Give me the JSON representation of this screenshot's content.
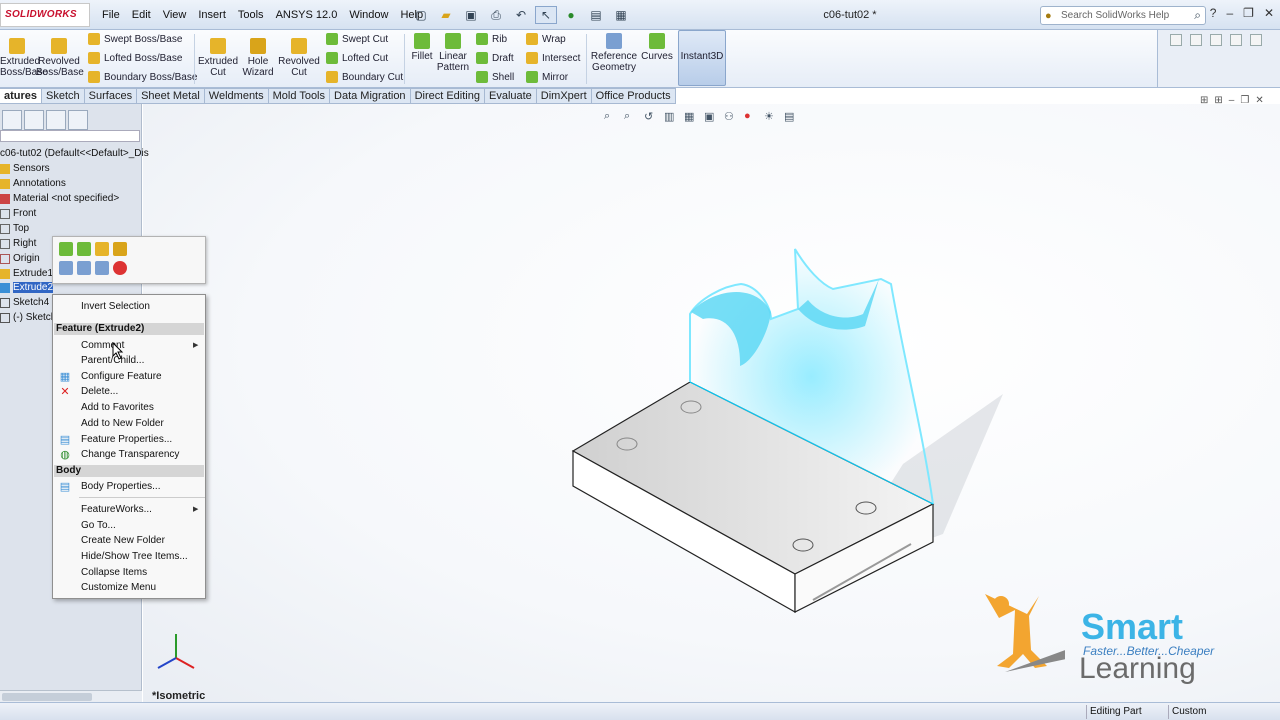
{
  "app": {
    "logo_text": "SOLIDWORKS",
    "doc_title": "c06-tut02 *"
  },
  "menu": [
    "File",
    "Edit",
    "View",
    "Insert",
    "Tools",
    "ANSYS 12.0",
    "Window",
    "Help"
  ],
  "search": {
    "placeholder": "Search SolidWorks Help"
  },
  "ribbon": {
    "big": [
      {
        "label1": "Extruded",
        "label2": "Boss/Base"
      },
      {
        "label1": "Revolved",
        "label2": "Boss/Base"
      },
      {
        "label1": "Extruded",
        "label2": "Cut"
      },
      {
        "label1": "Hole",
        "label2": "Wizard"
      },
      {
        "label1": "Revolved",
        "label2": "Cut"
      },
      {
        "label1": "Fillet",
        "label2": ""
      },
      {
        "label1": "Linear",
        "label2": "Pattern"
      },
      {
        "label1": "Reference",
        "label2": "Geometry"
      },
      {
        "label1": "Curves",
        "label2": ""
      },
      {
        "label1": "Instant3D",
        "label2": ""
      }
    ],
    "small": [
      "Swept Boss/Base",
      "Lofted Boss/Base",
      "Boundary Boss/Base",
      "Swept Cut",
      "Lofted Cut",
      "Boundary Cut",
      "Rib",
      "Draft",
      "Shell",
      "Wrap",
      "Intersect",
      "Mirror"
    ]
  },
  "tabs": [
    "atures",
    "Sketch",
    "Surfaces",
    "Sheet Metal",
    "Weldments",
    "Mold Tools",
    "Data Migration",
    "Direct Editing",
    "Evaluate",
    "DimXpert",
    "Office Products"
  ],
  "tree": [
    "c06-tut02  (Default<<Default>_Dis",
    "Sensors",
    "Annotations",
    "Material <not specified>",
    "Front",
    "Top",
    "Right",
    "Origin",
    "Extrude1",
    "Extrude2",
    "Sketch4",
    "(-) Sketch"
  ],
  "context_menu": {
    "top": "Invert Selection",
    "header1": "Feature (Extrude2)",
    "feature_items": [
      "Comment",
      "Parent/Child...",
      "Configure Feature",
      "Delete...",
      "Add to Favorites",
      "Add to New Folder",
      "Feature Properties...",
      "Change Transparency"
    ],
    "header2": "Body",
    "body_items": [
      "Body Properties...",
      "FeatureWorks...",
      "Go To...",
      "Create New Folder",
      "Hide/Show Tree Items...",
      "Collapse Items",
      "Customize Menu"
    ]
  },
  "view": {
    "orientation": "*Isometric"
  },
  "status": {
    "mode": "Editing Part",
    "units": "Custom"
  },
  "brand": {
    "name": "Smart",
    "tagline": "Faster...Better...Cheaper",
    "name2": "Learning"
  },
  "colors": {
    "highlight": "#3166c4",
    "accent": "#00c8ff"
  }
}
